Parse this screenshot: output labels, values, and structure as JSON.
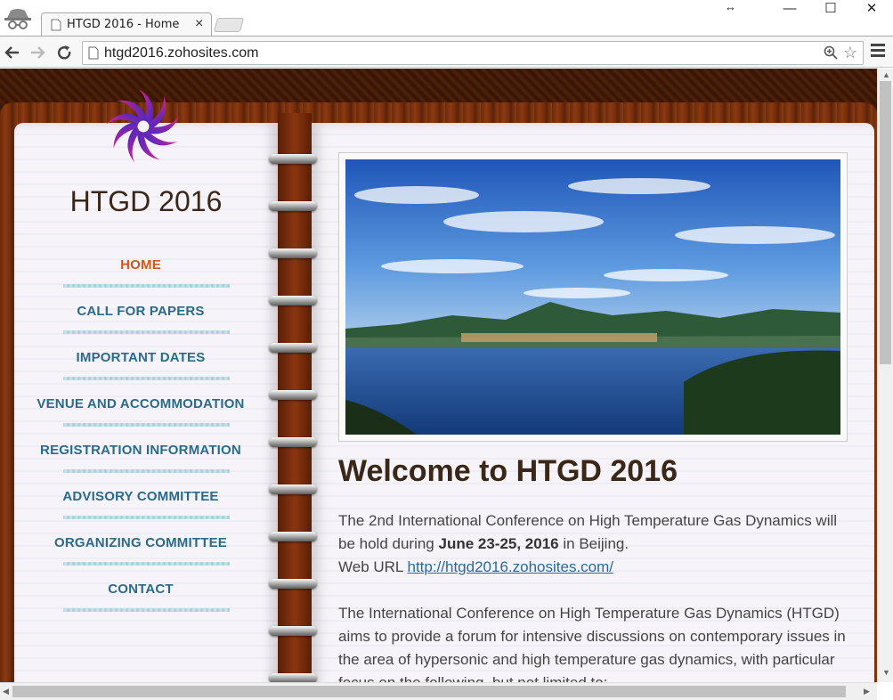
{
  "browser": {
    "tab_title": "HTGD 2016 - Home",
    "tab_close": "×",
    "url": "htgd2016.zohosites.com",
    "window_controls": {
      "minimize": "—",
      "maximize": "☐",
      "close": "✕"
    },
    "resize_indicator": "↔"
  },
  "site": {
    "title": "HTGD 2016",
    "nav": [
      {
        "label": "HOME",
        "active": true
      },
      {
        "label": "CALL FOR PAPERS"
      },
      {
        "label": "IMPORTANT DATES"
      },
      {
        "label": "VENUE AND ACCOMMODATION"
      },
      {
        "label": "REGISTRATION INFORMATION"
      },
      {
        "label": "ADVISORY COMMITTEE"
      },
      {
        "label": "ORGANIZING COMMITTEE"
      },
      {
        "label": "CONTACT"
      }
    ]
  },
  "main": {
    "heading": "Welcome to HTGD 2016",
    "p1_a": "The 2nd International Conference on High Temperature Gas Dynamics will be hold during ",
    "p1_bold": "June 23-25, 2016",
    "p1_b": " in Beijing.",
    "web_url_label": "Web URL ",
    "web_url_link": "http://htgd2016.zohosites.com/ ",
    "p2": "The International Conference on High Temperature Gas Dynamics (HTGD) aims to provide a forum for intensive discussions on contemporary issues in the area of hypersonic and high temperature gas dynamics, with particular focus on the following, but not limited to:"
  },
  "icons": [
    "incognito-icon",
    "page-icon",
    "back-icon",
    "forward-icon",
    "reload-icon",
    "zoom-icon",
    "star-icon",
    "menu-icon",
    "logo-icon"
  ],
  "colors": {
    "nav_active": "#d4551e",
    "nav_link": "#2a6a8a",
    "heading": "#3b2718"
  }
}
